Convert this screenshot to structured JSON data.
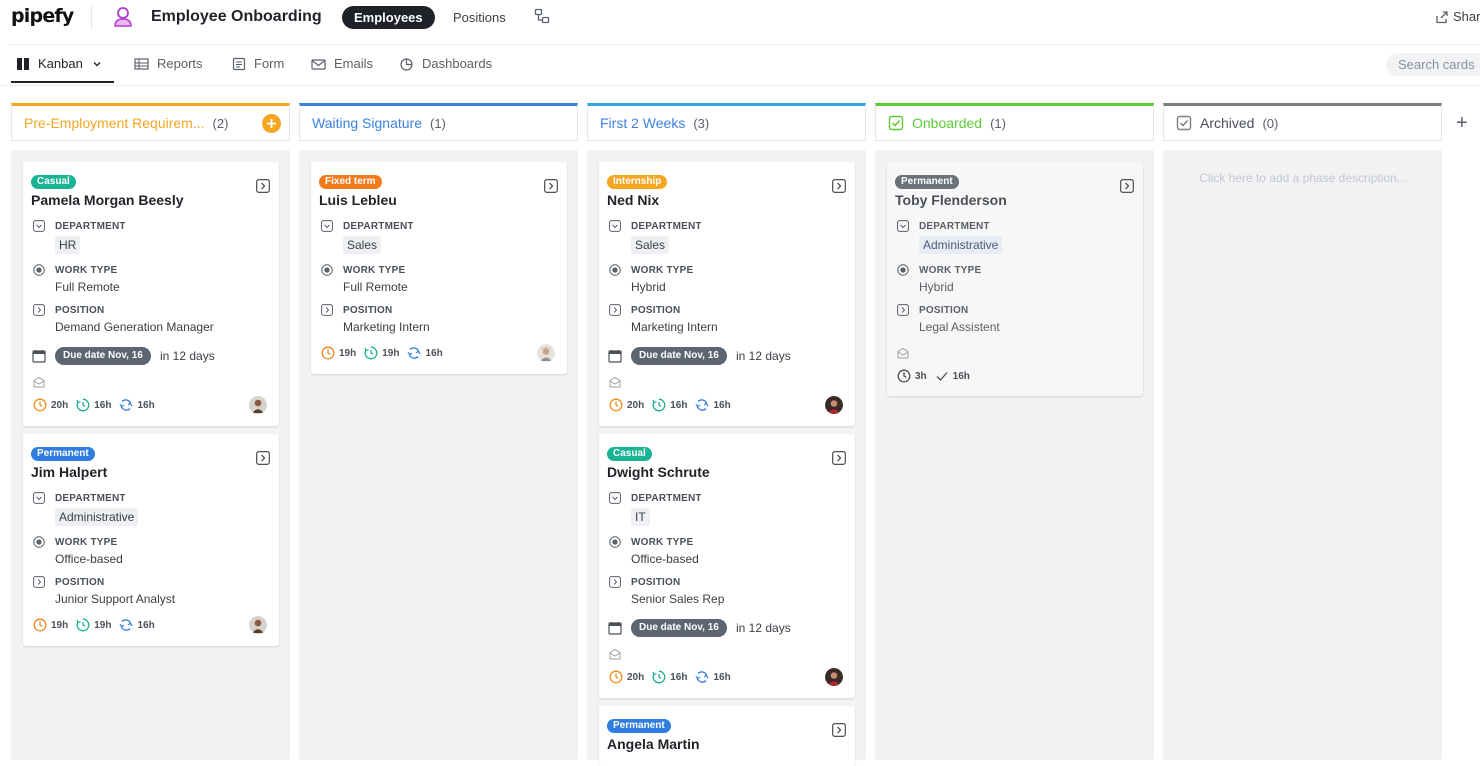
{
  "app": {
    "logo": "pipefy",
    "pipe_title": "Employee Onboarding",
    "tabs": [
      {
        "label": "Employees"
      },
      {
        "label": "Positions"
      }
    ],
    "share_label": "Shar"
  },
  "views": {
    "kanban": "Kanban",
    "reports": "Reports",
    "form": "Form",
    "emails": "Emails",
    "dashboards": "Dashboards",
    "search_placeholder": "Search cards"
  },
  "colors": {
    "pre_employment": "#f5a623",
    "waiting_signature": "#3b82e0",
    "first_weeks": "#3aa3e8",
    "onboarded": "#5ccb34",
    "archived": "#7a7f85",
    "tag_casual": "#1ab394",
    "tag_permanent": "#2f7de1",
    "tag_fixed": "#f47b1d",
    "tag_internship": "#f5a623",
    "tag_permanent_done": "#6b7178"
  },
  "labels": {
    "department": "DEPARTMENT",
    "work_type": "WORK TYPE",
    "position": "POSITION"
  },
  "phases": [
    {
      "name": "Pre-Employment Requirem...",
      "count": "(2)",
      "cards": [
        {
          "tag": "Casual",
          "title": "Pamela Morgan Beesly",
          "department": "HR",
          "work_type": "Full Remote",
          "position": "Demand Generation Manager",
          "due_badge": "Due date Nov, 16",
          "due_text": "in 12 days",
          "stats": [
            "20h",
            "16h",
            "16h"
          ]
        },
        {
          "tag": "Permanent",
          "title": "Jim Halpert",
          "department": "Administrative",
          "work_type": "Office-based",
          "position": "Junior Support Analyst",
          "stats": [
            "19h",
            "19h",
            "16h"
          ]
        }
      ]
    },
    {
      "name": "Waiting Signature",
      "count": "(1)",
      "cards": [
        {
          "tag": "Fixed term",
          "title": "Luis Lebleu",
          "department": "Sales",
          "work_type": "Full Remote",
          "position": "Marketing Intern",
          "stats": [
            "19h",
            "19h",
            "16h"
          ]
        }
      ]
    },
    {
      "name": "First 2 Weeks",
      "count": "(3)",
      "cards": [
        {
          "tag": "Internship",
          "title": "Ned Nix",
          "department": "Sales",
          "work_type": "Hybrid",
          "position": "Marketing Intern",
          "due_badge": "Due date Nov, 16",
          "due_text": "in 12 days",
          "stats": [
            "20h",
            "16h",
            "16h"
          ]
        },
        {
          "tag": "Casual",
          "title": "Dwight Schrute",
          "department": "IT",
          "work_type": "Office-based",
          "position": "Senior Sales Rep",
          "due_badge": "Due date Nov, 16",
          "due_text": "in 12 days",
          "stats": [
            "20h",
            "16h",
            "16h"
          ]
        },
        {
          "tag": "Permanent",
          "title": "Angela Martin"
        }
      ]
    },
    {
      "name": "Onboarded",
      "count": "(1)",
      "cards": [
        {
          "tag": "Permanent",
          "title": "Toby Flenderson",
          "department": "Administrative",
          "work_type": "Hybrid",
          "position": "Legal Assistent",
          "stats": [
            "3h",
            "16h"
          ]
        }
      ]
    },
    {
      "name": "Archived",
      "count": "(0)",
      "description": "Click here to add a phase description..."
    }
  ]
}
